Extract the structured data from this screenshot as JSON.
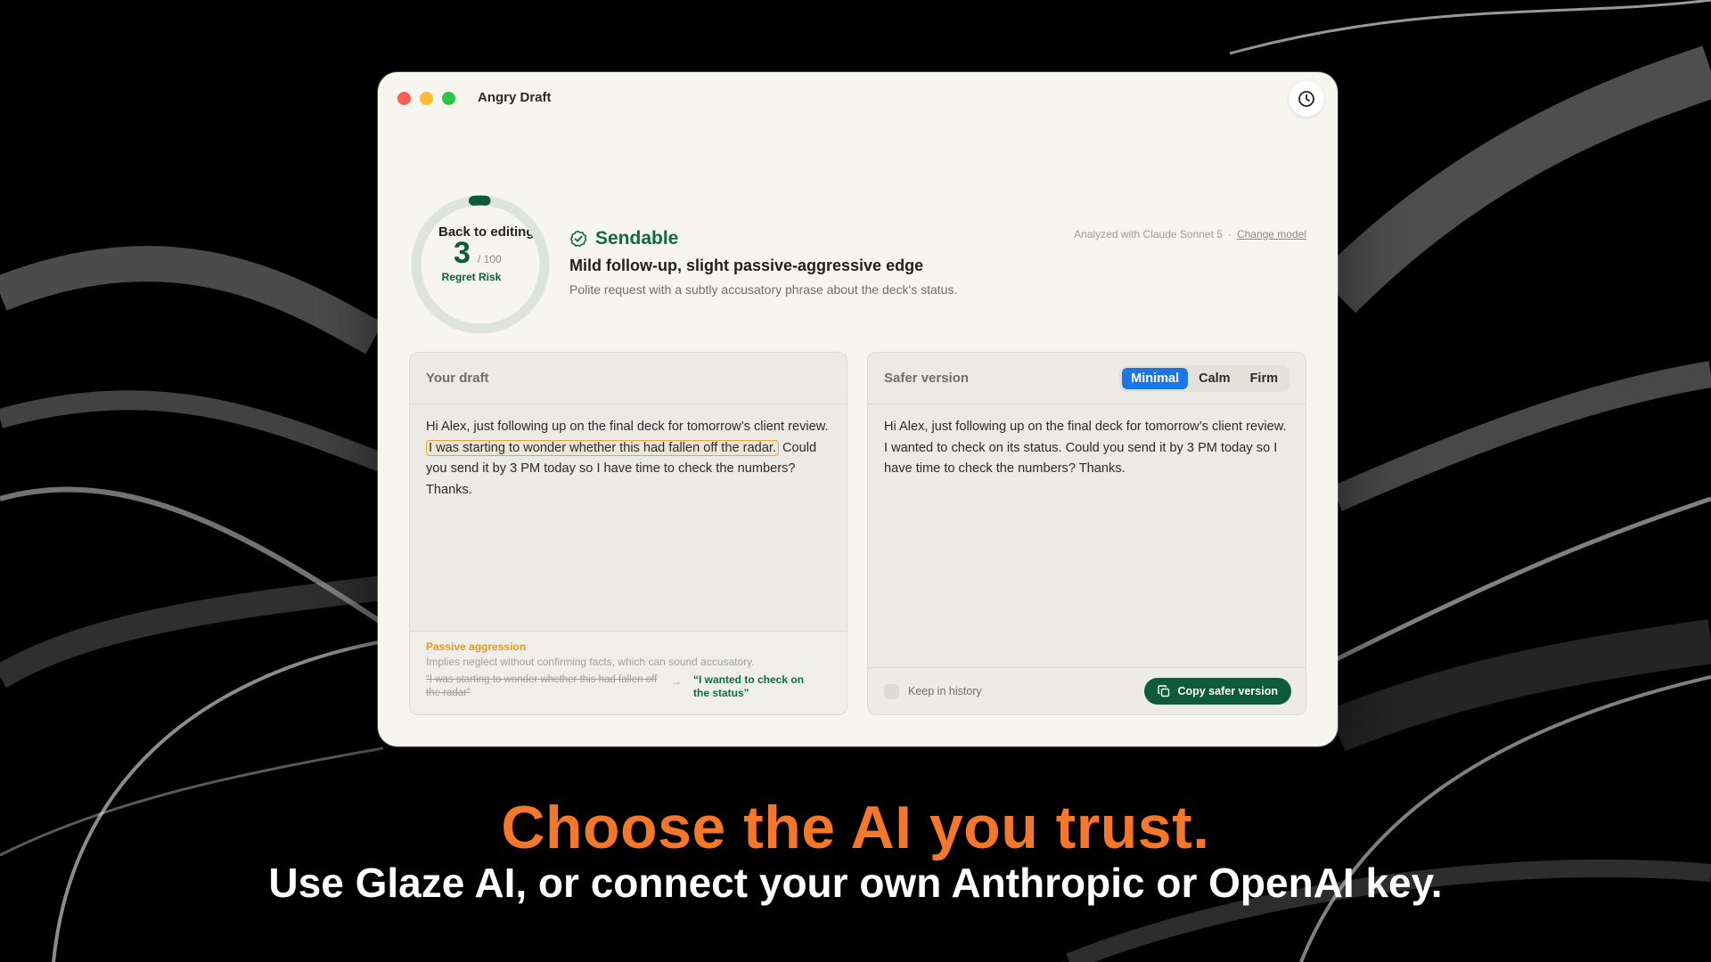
{
  "window": {
    "title": "Angry Draft",
    "back_label": "Back to editing",
    "analyzed_text": "Analyzed with Claude Sonnet 5",
    "separator": "·",
    "change_model_label": "Change model"
  },
  "score": {
    "value": "3",
    "max": "/ 100",
    "label": "Regret Risk",
    "fraction": 0.03
  },
  "verdict": {
    "status": "Sendable",
    "title": "Mild follow-up, slight passive-aggressive edge",
    "description": "Polite request with a subtly accusatory phrase about the deck's status."
  },
  "draft": {
    "header": "Your draft",
    "text_before": "Hi Alex, just following up on the final deck for tomorrow’s client review.",
    "text_highlight": "I was starting to wonder whether this had fallen off the radar.",
    "text_after": "Could you send it by 3 PM today so I have time to check the numbers? Thanks.",
    "issue": {
      "type": "Passive aggression",
      "description": "Implies neglect without confirming facts, which can sound accusatory.",
      "original": "“I was starting to wonder whether this had fallen off the radar”",
      "replacement": "“I wanted to check on the status”"
    }
  },
  "safer": {
    "header": "Safer version",
    "tones": [
      "Minimal",
      "Calm",
      "Firm"
    ],
    "active_tone": "Minimal",
    "text": "Hi Alex, just following up on the final deck for tomorrow’s client review. I wanted to check on its status. Could you send it by 3 PM today so I have time to check the numbers? Thanks.",
    "keep_history_label": "Keep in history",
    "copy_label": "Copy safer version"
  },
  "captions": {
    "headline": "Choose the AI you trust.",
    "subline": "Use Glaze AI, or connect your own Anthropic or OpenAI key."
  },
  "colors": {
    "accent_green": "#0f5a3f",
    "highlight_orange": "#f0a23a",
    "caption_orange": "#f4772a",
    "segment_blue": "#1b77e6"
  }
}
